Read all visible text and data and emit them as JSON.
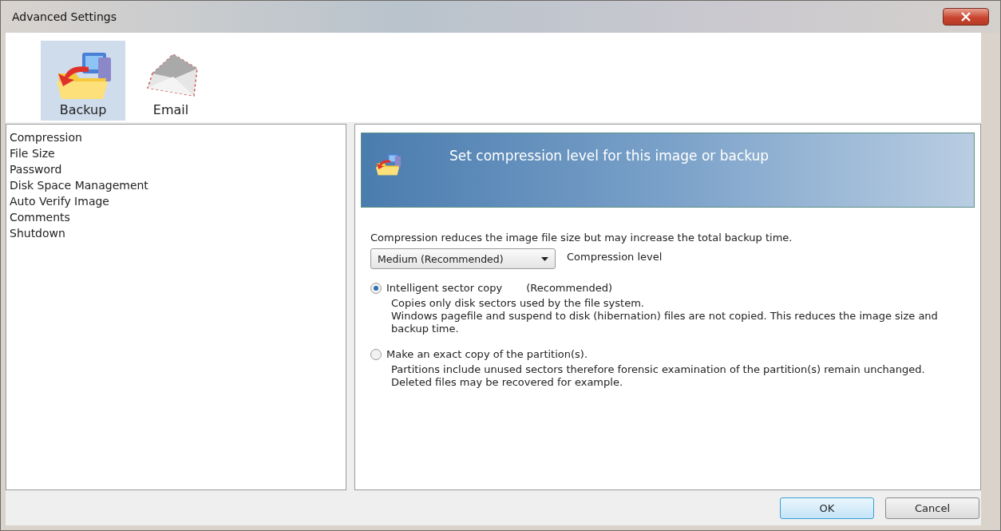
{
  "window": {
    "title": "Advanced Settings"
  },
  "tabs": [
    {
      "label": "Backup",
      "kind": "backup",
      "selected": true
    },
    {
      "label": "Email",
      "kind": "email",
      "selected": false
    }
  ],
  "sidebar": {
    "items": [
      "Compression",
      "File Size",
      "Password",
      "Disk Space Management",
      "Auto Verify Image",
      "Comments",
      "Shutdown"
    ]
  },
  "panel": {
    "header": "Set compression level for this image or backup",
    "description": "Compression reduces the image file size but may increase the total backup time.",
    "dropdown": {
      "value": "Medium (Recommended)",
      "label": "Compression level"
    },
    "options": [
      {
        "label": "Intelligent sector copy",
        "note": "(Recommended)",
        "selected": true,
        "details": [
          "Copies only disk sectors used by the file system.",
          "Windows pagefile and suspend to disk (hibernation) files are not copied. This reduces the image size and backup time."
        ]
      },
      {
        "label": "Make an exact copy of the partition(s).",
        "selected": false,
        "details": [
          "Partitions include unused sectors therefore forensic examination of the partition(s) remain unchanged. Deleted files may be recovered for example."
        ]
      }
    ]
  },
  "buttons": [
    {
      "label": "OK",
      "default": true
    },
    {
      "label": "Cancel",
      "default": false
    }
  ]
}
